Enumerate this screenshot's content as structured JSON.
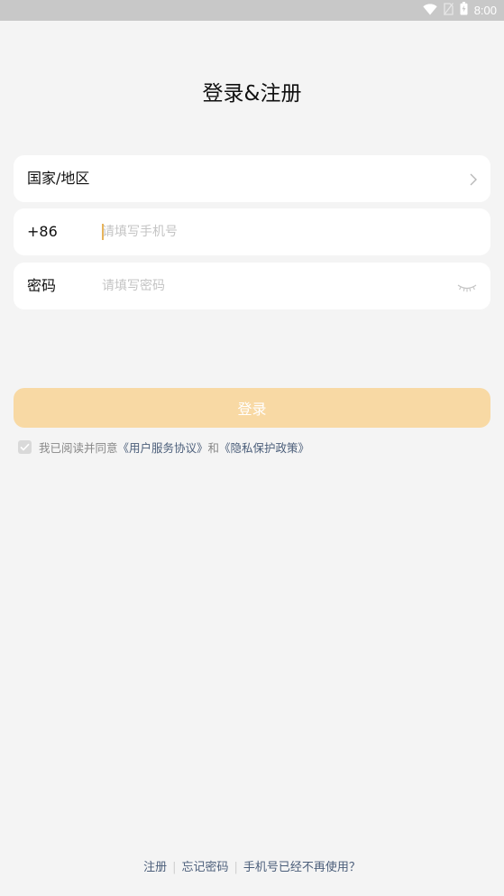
{
  "status_bar": {
    "time": "8:00",
    "icons": [
      "wifi-icon",
      "no-sim-icon",
      "battery-icon"
    ]
  },
  "page": {
    "title": "登录&注册"
  },
  "form": {
    "region_label": "国家/地区",
    "phone_prefix": "+86",
    "phone_placeholder": "请填写手机号",
    "password_label": "密码",
    "password_placeholder": "请填写密码"
  },
  "actions": {
    "login_label": "登录"
  },
  "agreement": {
    "checked": true,
    "prefix": "我已阅读并同意",
    "user_agreement": "《用户服务协议》",
    "conjunction": "和",
    "privacy_policy": "《隐私保护政策》"
  },
  "footer": {
    "register": "注册",
    "forgot_password": "忘记密码",
    "phone_unavailable": "手机号已经不再使用？"
  },
  "colors": {
    "background": "#f4f4f4",
    "accent": "#f8d9a4",
    "caret": "#e7b45c",
    "link": "#4b5e7a"
  }
}
